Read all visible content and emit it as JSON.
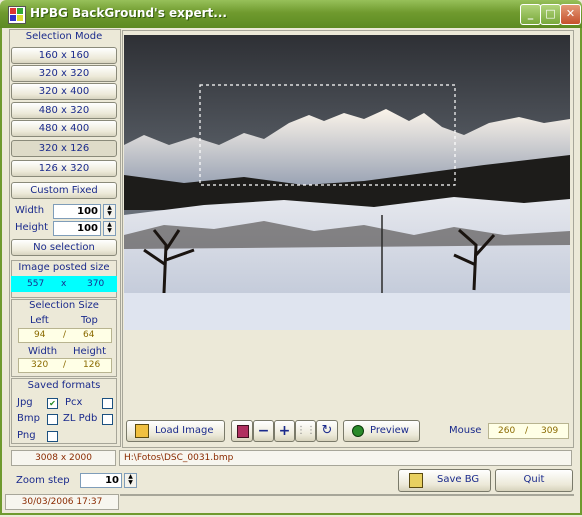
{
  "window": {
    "title": "HPBG BackGround's expert..."
  },
  "selection_mode": {
    "header": "Selection Mode",
    "sizes": [
      "160 x 160",
      "320 x 320",
      "320 x 400",
      "480 x 320",
      "480 x 400",
      "320 x 126",
      "126 x 320"
    ],
    "custom_fixed": "Custom Fixed",
    "width_label": "Width",
    "width_value": "100",
    "height_label": "Height",
    "height_value": "100",
    "no_selection": "No selection"
  },
  "image_posted_size": {
    "header": "Image posted size",
    "width": "557",
    "sep": "x",
    "height": "370"
  },
  "selection_size": {
    "header": "Selection Size",
    "left_label": "Left",
    "top_label": "Top",
    "left": "94",
    "top": "64",
    "width_label": "Width",
    "height_label": "Height",
    "width": "320",
    "height": "126",
    "sep": "/"
  },
  "saved_formats": {
    "header": "Saved formats",
    "items": [
      {
        "label": "Jpg",
        "checked": true,
        "mark": "✔"
      },
      {
        "label": "Pcx",
        "checked": false,
        "mark": ""
      },
      {
        "label": "Bmp",
        "checked": false,
        "mark": ""
      },
      {
        "label": "ZL Pdb",
        "checked": false,
        "mark": ""
      },
      {
        "label": "Png",
        "checked": false,
        "mark": ""
      }
    ]
  },
  "toolbar": {
    "load_label": "Load Image",
    "preview_label": "Preview",
    "mouse_label": "Mouse",
    "mouse_x": "260",
    "mouse_y": "309",
    "mouse_sep": "/",
    "zoom_out": "−",
    "zoom_in": "+"
  },
  "status": {
    "original_size": "3008  x  2000",
    "path": "H:\\Fotos\\DSC_0031.bmp",
    "datetime": "30/03/2006 17:37"
  },
  "zoom": {
    "label": "Zoom step",
    "value": "10"
  },
  "actions": {
    "save_label": "Save BG",
    "quit_label": "Quit"
  },
  "colors": {
    "titlebar": "#6f9a2e",
    "posted_size_bg": "#00ffff",
    "text": "#1a2a8c"
  }
}
